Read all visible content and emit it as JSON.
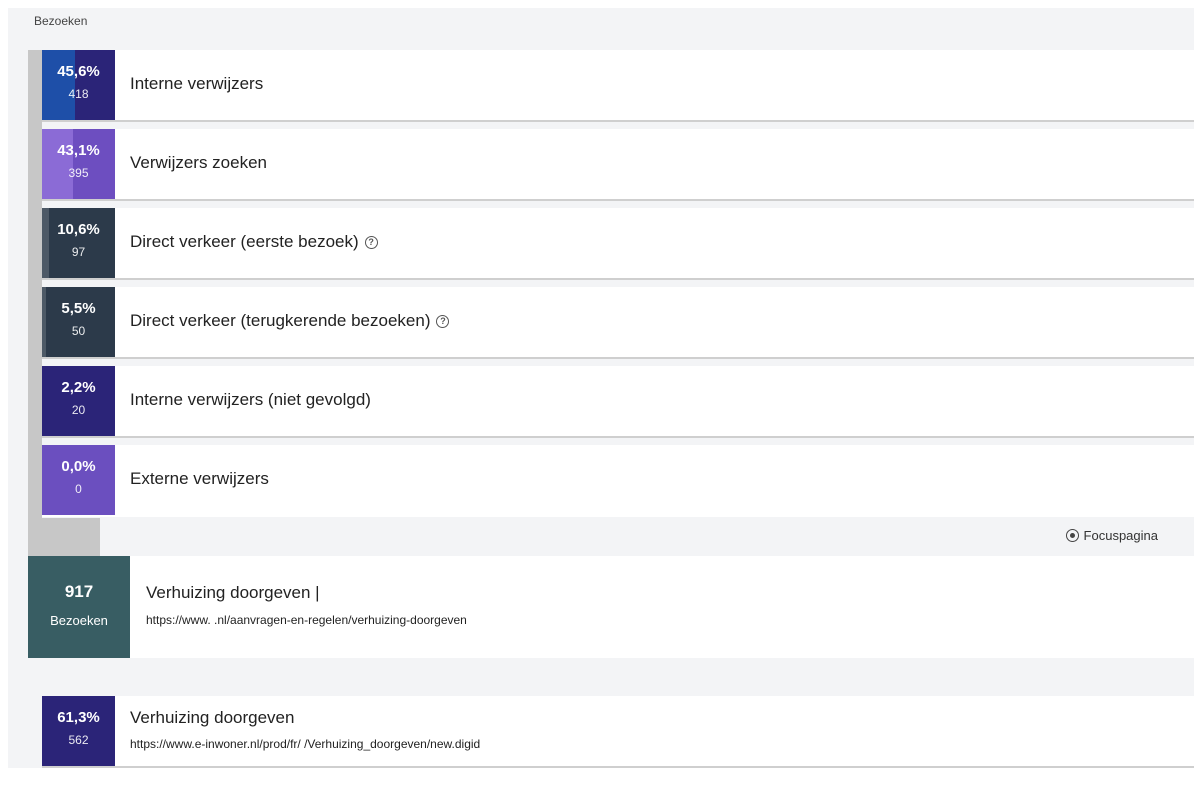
{
  "header": {
    "label": "Bezoeken"
  },
  "colors": {
    "interne": "#2b2478",
    "zoeken": "#8060c8",
    "direct": "#2c3a4a",
    "extern": "#6b4fbf",
    "focus": "#385d63"
  },
  "channels": [
    {
      "pct": "45,6%",
      "count": "418",
      "label": "Interne verwijzers",
      "help": false
    },
    {
      "pct": "43,1%",
      "count": "395",
      "label": "Verwijzers zoeken",
      "help": false
    },
    {
      "pct": "10,6%",
      "count": "97",
      "label": "Direct verkeer (eerste bezoek)",
      "help": true
    },
    {
      "pct": "5,5%",
      "count": "50",
      "label": "Direct verkeer (terugkerende bezoeken)",
      "help": true
    },
    {
      "pct": "2,2%",
      "count": "20",
      "label": "Interne verwijzers (niet gevolgd)",
      "help": false
    },
    {
      "pct": "0,0%",
      "count": "0",
      "label": "Externe verwijzers",
      "help": false
    }
  ],
  "focus": {
    "button_label": "Focuspagina",
    "count": "917",
    "count_label": "Bezoeken",
    "title": "Verhuizing doorgeven |",
    "url": "https://www.              .nl/aanvragen-en-regelen/verhuizing-doorgeven"
  },
  "exit": {
    "pct": "61,3%",
    "count": "562",
    "title": "Verhuizing doorgeven",
    "url": "https://www.e-inwoner.nl/prod/fr/                  /Verhuizing_doorgeven/new.digid"
  }
}
